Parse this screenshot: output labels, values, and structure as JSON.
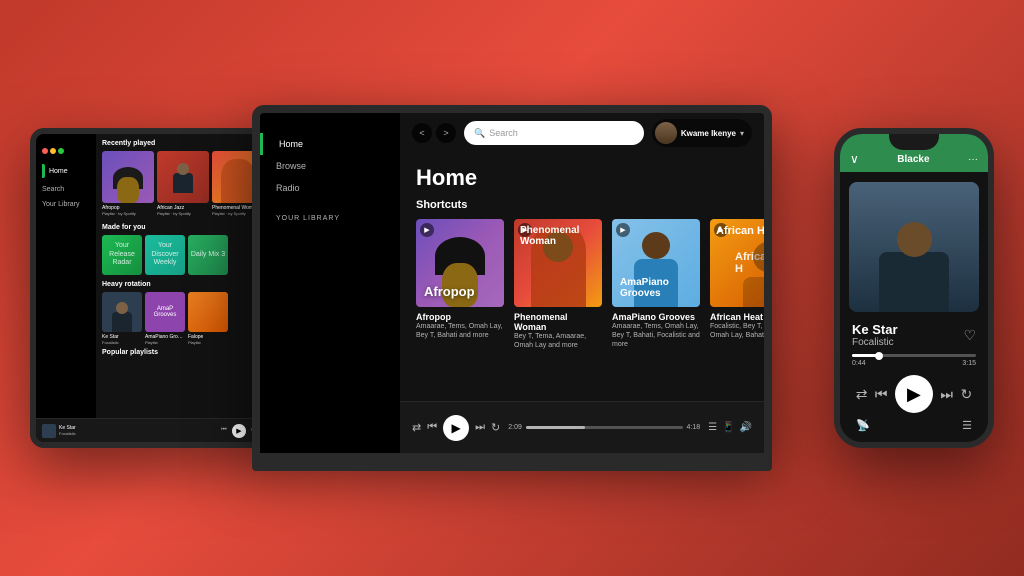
{
  "app": {
    "name": "Spotify",
    "background": "red-gradient"
  },
  "laptop": {
    "sidebar": {
      "items": [
        {
          "label": "Home",
          "active": true
        },
        {
          "label": "Browse",
          "active": false
        },
        {
          "label": "Radio",
          "active": false
        }
      ],
      "library_label": "YOUR LIBRARY"
    },
    "topbar": {
      "search_placeholder": "Search",
      "user_name": "Kwame Ikenye",
      "back_label": "<",
      "forward_label": ">"
    },
    "home": {
      "title": "Home",
      "shortcuts_label": "Shortcuts",
      "cards": [
        {
          "title": "Afropop",
          "subtitle": "Amaarae, Tems, Omah Lay, Bey T, Bahati and more",
          "type": "afropop"
        },
        {
          "title": "Phenomenal Woman",
          "subtitle": "Bey T, Tema, Amaarae, Omah Lay and more",
          "type": "woman"
        },
        {
          "title": "AmaPiano Grooves",
          "subtitle": "Amaarae, Tems, Omah Lay, Bey T, Bahati, Focalistic and more",
          "type": "amapiano"
        },
        {
          "title": "African Heat",
          "subtitle": "Focalistic, Bey T, Tem Omah Lay, Bahati an...",
          "type": "african"
        }
      ]
    },
    "player": {
      "time_elapsed": "2:09",
      "time_total": "4:18"
    }
  },
  "tablet": {
    "sidebar": {
      "items": [
        {
          "label": "Home",
          "active": true
        },
        {
          "label": "Search"
        },
        {
          "label": "Your Library"
        }
      ]
    },
    "recently_played_label": "Recently played",
    "made_for_you_label": "Made for you",
    "heavy_rotation_label": "Heavy rotation",
    "popular_playlists_label": "Popular playlists",
    "now_playing": {
      "title": "Ke Star",
      "artist": "Focalistic"
    }
  },
  "phone": {
    "header": {
      "title": "Blacke",
      "chevron": "∨",
      "dots": "···"
    },
    "now_playing": {
      "title": "Ke Star",
      "artist": "Focalistic"
    },
    "progress": {
      "elapsed": "0:44",
      "total": "3:15"
    }
  }
}
